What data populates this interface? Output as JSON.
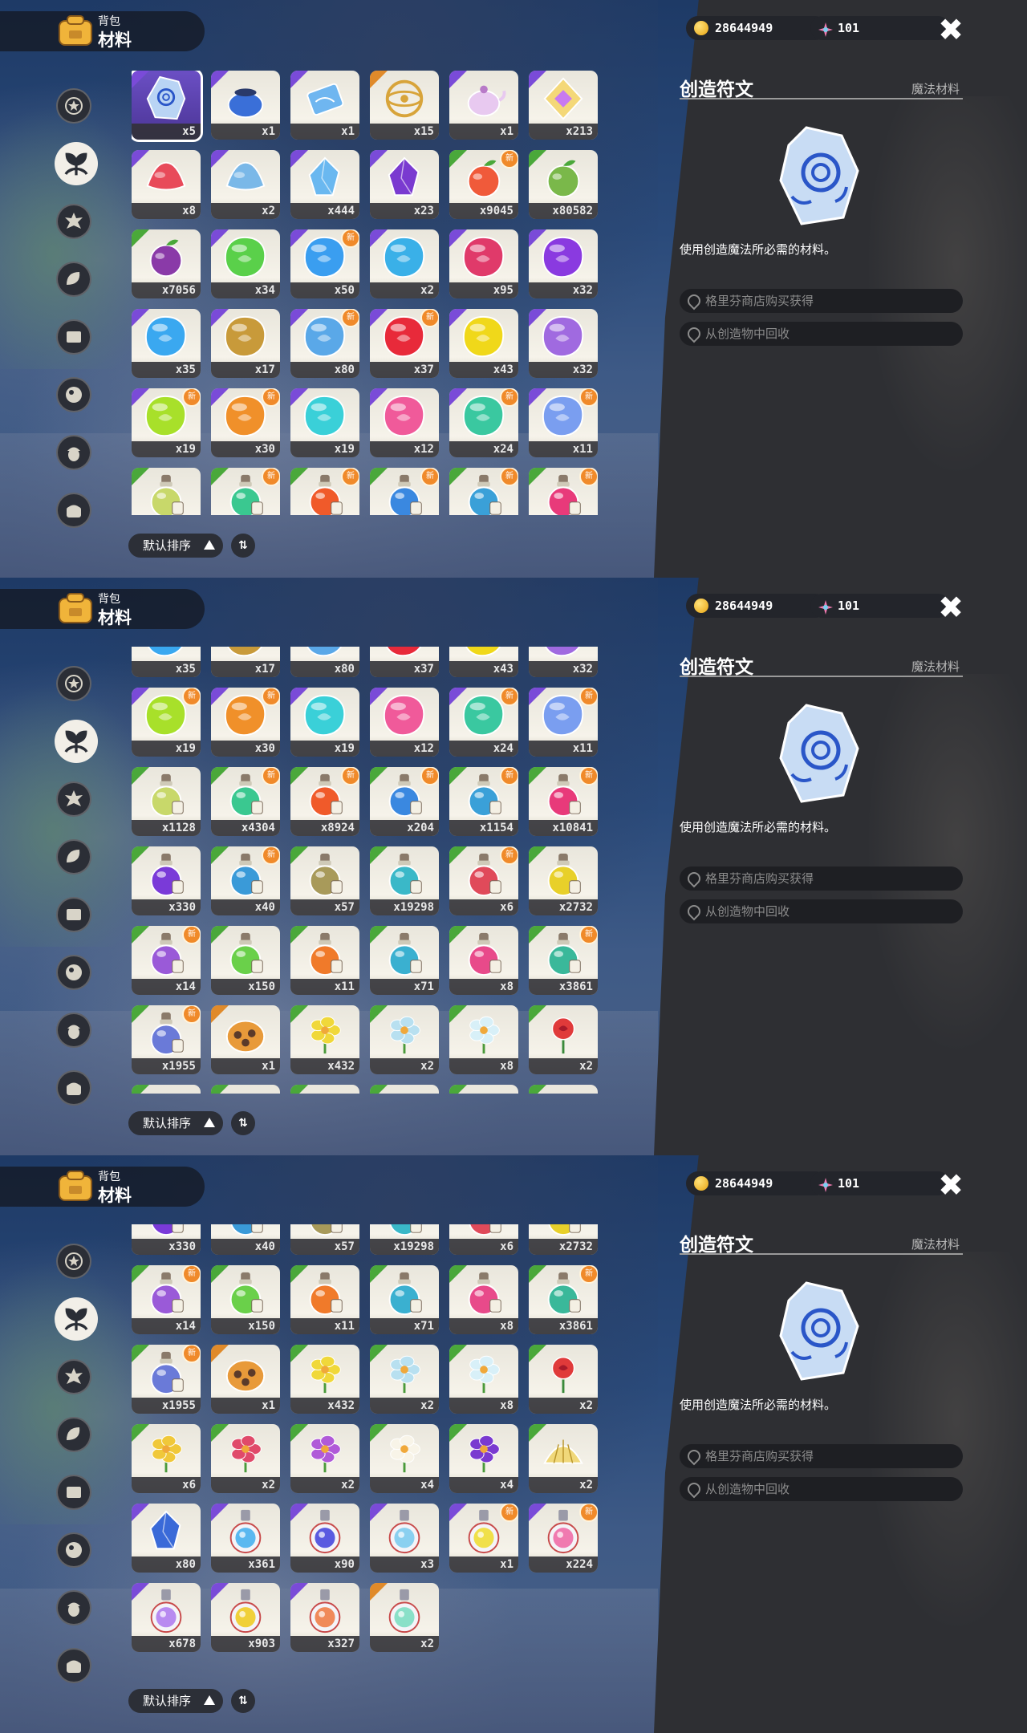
{
  "header": {
    "section_label": "背包",
    "tab_label": "材料"
  },
  "currency": {
    "gold": "28644949",
    "gems": "101"
  },
  "detail": {
    "title": "创造符文",
    "subtype": "魔法材料",
    "description": "使用创造魔法所必需的材料。",
    "sources": [
      "格里芬商店购买获得",
      "从创造物中回收"
    ]
  },
  "sort": {
    "label": "默认排序",
    "toggle": "⇅"
  },
  "new_badge": "新",
  "close_label": "✖",
  "categories": [
    "star-badge-icon",
    "leaf-icon",
    "spiky-gem-icon",
    "seed-icon",
    "scroll-icon",
    "orb-icon",
    "acorn-icon",
    "chest-icon"
  ],
  "items": [
    {
      "count": "x5",
      "kind": "rune",
      "color": "#b9d4f4",
      "rarity": "#7a4bd8"
    },
    {
      "count": "x1",
      "kind": "pot",
      "color": "#3a6fd8",
      "rarity": "#7a4bd8"
    },
    {
      "count": "x1",
      "kind": "scroll",
      "color": "#6fb6f0",
      "rarity": "#7a4bd8"
    },
    {
      "count": "x15",
      "kind": "astrolabe",
      "color": "#d8a43a",
      "rarity": "#e08a2a"
    },
    {
      "count": "x1",
      "kind": "teapot",
      "color": "#e8c9f0",
      "rarity": "#7a4bd8"
    },
    {
      "count": "x213",
      "kind": "gemcard",
      "color": "#f4d878",
      "rarity": "#7a4bd8"
    },
    {
      "count": "x8",
      "kind": "cloth",
      "color": "#e84a5a",
      "rarity": "#7a4bd8"
    },
    {
      "count": "x2",
      "kind": "cloth",
      "color": "#7ab8e8",
      "rarity": "#7a4bd8"
    },
    {
      "count": "x444",
      "kind": "crystal",
      "color": "#6ab8f0",
      "rarity": "#7a4bd8"
    },
    {
      "count": "x23",
      "kind": "crystal",
      "color": "#7a3ad0",
      "rarity": "#7a4bd8"
    },
    {
      "count": "x9045",
      "kind": "fruit",
      "color": "#f05a3a",
      "rarity": "#4aa83a",
      "new": true
    },
    {
      "count": "x80582",
      "kind": "fruit",
      "color": "#7ab84a",
      "rarity": "#4aa83a"
    },
    {
      "count": "x7056",
      "kind": "fruit",
      "color": "#8a3aa8",
      "rarity": "#4aa83a"
    },
    {
      "count": "x34",
      "kind": "stone",
      "color": "#5ad04a",
      "rarity": "#7a4bd8"
    },
    {
      "count": "x50",
      "kind": "stone",
      "color": "#3a9ef0",
      "rarity": "#7a4bd8",
      "new": true
    },
    {
      "count": "x2",
      "kind": "stone",
      "color": "#3ab0e8",
      "rarity": "#7a4bd8"
    },
    {
      "count": "x95",
      "kind": "stone",
      "color": "#e03a6a",
      "rarity": "#7a4bd8"
    },
    {
      "count": "x32",
      "kind": "stone",
      "color": "#8a3ae0",
      "rarity": "#7a4bd8"
    },
    {
      "count": "x35",
      "kind": "stone",
      "color": "#3aa8f0",
      "rarity": "#7a4bd8"
    },
    {
      "count": "x17",
      "kind": "stone",
      "color": "#c89a3a",
      "rarity": "#7a4bd8"
    },
    {
      "count": "x80",
      "kind": "stone",
      "color": "#5aa8e8",
      "rarity": "#7a4bd8",
      "new": true
    },
    {
      "count": "x37",
      "kind": "stone",
      "color": "#e82a3a",
      "rarity": "#7a4bd8",
      "new": true
    },
    {
      "count": "x43",
      "kind": "stone",
      "color": "#f0d81a",
      "rarity": "#7a4bd8"
    },
    {
      "count": "x32",
      "kind": "stone",
      "color": "#a06ae0",
      "rarity": "#7a4bd8"
    },
    {
      "count": "x19",
      "kind": "stone",
      "color": "#a8e02a",
      "rarity": "#7a4bd8",
      "new": true
    },
    {
      "count": "x30",
      "kind": "stone",
      "color": "#f0902a",
      "rarity": "#7a4bd8",
      "new": true
    },
    {
      "count": "x19",
      "kind": "stone",
      "color": "#3ad0d8",
      "rarity": "#7a4bd8"
    },
    {
      "count": "x12",
      "kind": "stone",
      "color": "#f05a9a",
      "rarity": "#7a4bd8"
    },
    {
      "count": "x24",
      "kind": "stone",
      "color": "#3ac8a0",
      "rarity": "#7a4bd8",
      "new": true
    },
    {
      "count": "x11",
      "kind": "stone",
      "color": "#7a9ef0",
      "rarity": "#7a4bd8",
      "new": true
    },
    {
      "count": "x1128",
      "kind": "bottle",
      "color": "#c8d86a",
      "rarity": "#4aa83a"
    },
    {
      "count": "x4304",
      "kind": "flask",
      "color": "#3ac890",
      "rarity": "#4aa83a",
      "new": true
    },
    {
      "count": "x8924",
      "kind": "flask",
      "color": "#f05a2a",
      "rarity": "#4aa83a",
      "new": true
    },
    {
      "count": "x204",
      "kind": "flask",
      "color": "#3a88e0",
      "rarity": "#4aa83a",
      "new": true
    },
    {
      "count": "x1154",
      "kind": "flask",
      "color": "#3aa0d8",
      "rarity": "#4aa83a",
      "new": true
    },
    {
      "count": "x10841",
      "kind": "flask",
      "color": "#e83a7a",
      "rarity": "#4aa83a",
      "new": true
    },
    {
      "count": "x330",
      "kind": "flask",
      "color": "#7a3ad8",
      "rarity": "#4aa83a"
    },
    {
      "count": "x40",
      "kind": "flask",
      "color": "#3a9ad8",
      "rarity": "#4aa83a",
      "new": true
    },
    {
      "count": "x57",
      "kind": "flask",
      "color": "#a89a5a",
      "rarity": "#4aa83a"
    },
    {
      "count": "x19298",
      "kind": "flask",
      "color": "#3ab8c8",
      "rarity": "#4aa83a"
    },
    {
      "count": "x6",
      "kind": "flask",
      "color": "#e04a5a",
      "rarity": "#4aa83a",
      "new": true
    },
    {
      "count": "x2732",
      "kind": "flask",
      "color": "#e8d02a",
      "rarity": "#4aa83a"
    },
    {
      "count": "x14",
      "kind": "flask",
      "color": "#9a5ad8",
      "rarity": "#4aa83a",
      "new": true
    },
    {
      "count": "x150",
      "kind": "flask",
      "color": "#6ad04a",
      "rarity": "#4aa83a"
    },
    {
      "count": "x11",
      "kind": "flask",
      "color": "#f07a2a",
      "rarity": "#4aa83a"
    },
    {
      "count": "x71",
      "kind": "flask",
      "color": "#3ab0d0",
      "rarity": "#4aa83a"
    },
    {
      "count": "x8",
      "kind": "flask",
      "color": "#e84a8a",
      "rarity": "#4aa83a"
    },
    {
      "count": "x3861",
      "kind": "flask",
      "color": "#3ab89a",
      "rarity": "#4aa83a",
      "new": true
    },
    {
      "count": "x1955",
      "kind": "flask",
      "color": "#6a7ad8",
      "rarity": "#4aa83a",
      "new": true
    },
    {
      "count": "x1",
      "kind": "pumpkin",
      "color": "#e89a3a",
      "rarity": "#e08a2a"
    },
    {
      "count": "x432",
      "kind": "flower",
      "color": "#f0d83a",
      "rarity": "#4aa83a"
    },
    {
      "count": "x2",
      "kind": "bell",
      "color": "#b8e0f0",
      "rarity": "#4aa83a"
    },
    {
      "count": "x8",
      "kind": "flower",
      "color": "#d8f0f8",
      "rarity": "#4aa83a"
    },
    {
      "count": "x2",
      "kind": "rose",
      "color": "#e03a3a",
      "rarity": "#4aa83a"
    },
    {
      "count": "x6",
      "kind": "flower",
      "color": "#f0c83a",
      "rarity": "#4aa83a"
    },
    {
      "count": "x2",
      "kind": "flower",
      "color": "#e04a6a",
      "rarity": "#4aa83a"
    },
    {
      "count": "x2",
      "kind": "flower",
      "color": "#b05ad8",
      "rarity": "#4aa83a"
    },
    {
      "count": "x4",
      "kind": "flower",
      "color": "#f8f4e8",
      "rarity": "#4aa83a"
    },
    {
      "count": "x4",
      "kind": "flower",
      "color": "#7a3ad0",
      "rarity": "#4aa83a"
    },
    {
      "count": "x2",
      "kind": "shell",
      "color": "#f0d87a",
      "rarity": "#4aa83a"
    },
    {
      "count": "x80",
      "kind": "crystal",
      "color": "#3a6ad8",
      "rarity": "#7a4bd8"
    },
    {
      "count": "x361",
      "kind": "orbflask",
      "color": "#5ab8f0",
      "rarity": "#7a4bd8"
    },
    {
      "count": "x90",
      "kind": "orbflask",
      "color": "#5a5ae0",
      "rarity": "#7a4bd8"
    },
    {
      "count": "x3",
      "kind": "orbflask",
      "color": "#8ad0f0",
      "rarity": "#7a4bd8"
    },
    {
      "count": "x1",
      "kind": "orbflask",
      "color": "#f0e04a",
      "rarity": "#7a4bd8",
      "new": true
    },
    {
      "count": "x224",
      "kind": "orbflask",
      "color": "#f07ab0",
      "rarity": "#7a4bd8",
      "new": true
    },
    {
      "count": "x678",
      "kind": "orbflask",
      "color": "#b88af0",
      "rarity": "#7a4bd8"
    },
    {
      "count": "x903",
      "kind": "orbflask",
      "color": "#f0d03a",
      "rarity": "#7a4bd8"
    },
    {
      "count": "x327",
      "kind": "orbflask",
      "color": "#f08a5a",
      "rarity": "#7a4bd8"
    },
    {
      "count": "x2",
      "kind": "orbflask",
      "color": "#8ae0c8",
      "rarity": "#e08a2a"
    }
  ]
}
